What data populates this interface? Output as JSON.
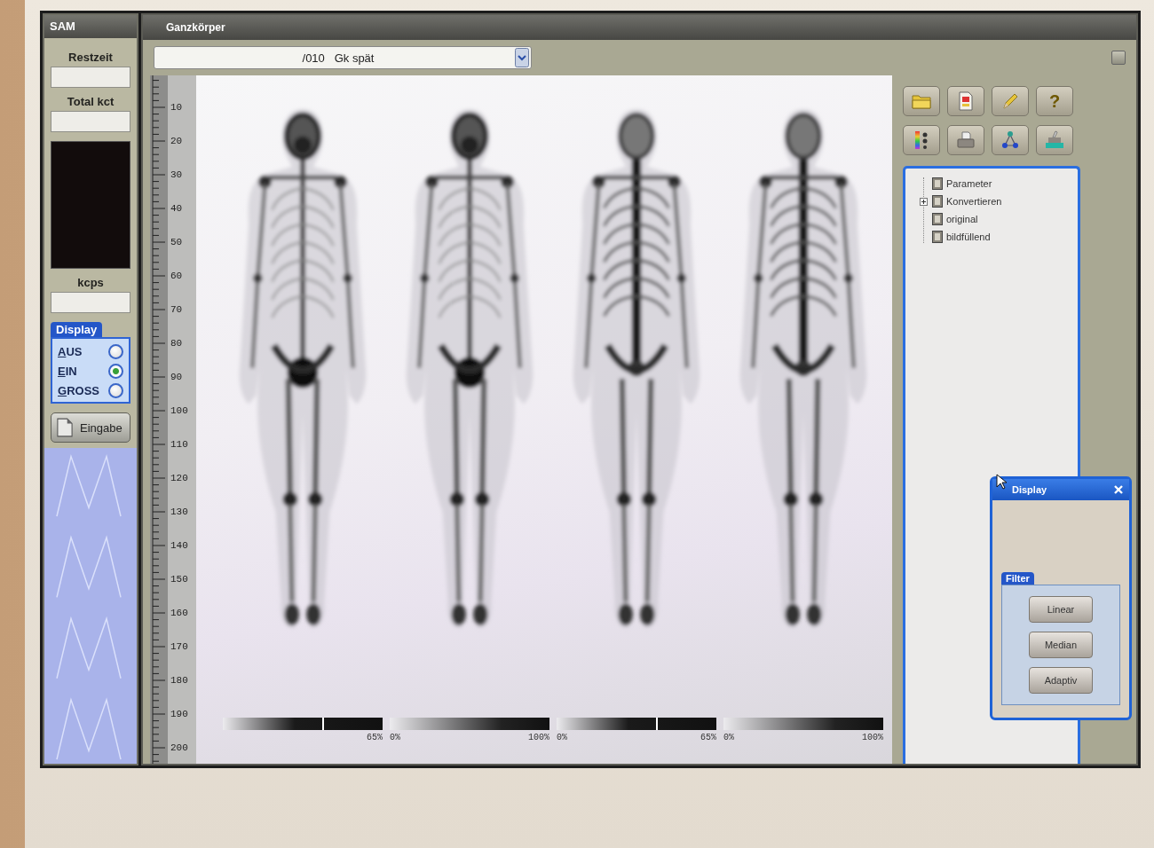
{
  "left_panel": {
    "title": "SAM",
    "items": [
      {
        "kind": "field",
        "label": "Restzeit"
      },
      {
        "kind": "field",
        "label": "Total kct"
      },
      {
        "kind": "display"
      },
      {
        "kind": "field",
        "label": "kcps"
      }
    ],
    "display_group": {
      "title": "Display",
      "options": [
        {
          "label": "AUS",
          "selected": false
        },
        {
          "label": "EIN",
          "selected": true
        },
        {
          "label": "GROSS",
          "selected": false
        }
      ]
    },
    "input_button": {
      "label": "Eingabe"
    }
  },
  "main_window": {
    "title": "Ganzkörper",
    "selector": {
      "value": "/010   Gk spät"
    },
    "ruler": {
      "labels": [
        "10",
        "20",
        "30",
        "40",
        "50",
        "60",
        "70",
        "80",
        "90",
        "100",
        "110",
        "120",
        "130",
        "140",
        "150",
        "160",
        "170",
        "180",
        "190",
        "200"
      ]
    },
    "scans": [
      {
        "kind": "anterior"
      },
      {
        "kind": "anterior"
      },
      {
        "kind": "posterior"
      },
      {
        "kind": "posterior"
      }
    ],
    "scale_bars": [
      {
        "max": "65%",
        "split": true
      },
      {
        "min": "0%",
        "max": "100%",
        "split": false
      },
      {
        "min": "0%",
        "max": "65%",
        "split": true
      },
      {
        "min": "0%",
        "max": "100%",
        "split": false
      }
    ]
  },
  "tools": {
    "toolbar": [
      {
        "kind": "folder"
      },
      {
        "kind": "document"
      },
      {
        "kind": "pencil"
      },
      {
        "kind": "help",
        "label": "?"
      },
      {
        "kind": "palette"
      },
      {
        "kind": "printer"
      },
      {
        "kind": "network"
      },
      {
        "kind": "tray"
      }
    ],
    "tree": {
      "items": [
        {
          "label": "Parameter",
          "expander": false
        },
        {
          "label": "Konvertieren",
          "expander": true
        },
        {
          "label": "original",
          "expander": false
        },
        {
          "label": "bildfüllend",
          "expander": false
        }
      ]
    }
  },
  "filter_dialog": {
    "title": "Display",
    "group": {
      "title": "Filter",
      "buttons": [
        "Linear",
        "Median",
        "Adaptiv"
      ]
    }
  }
}
